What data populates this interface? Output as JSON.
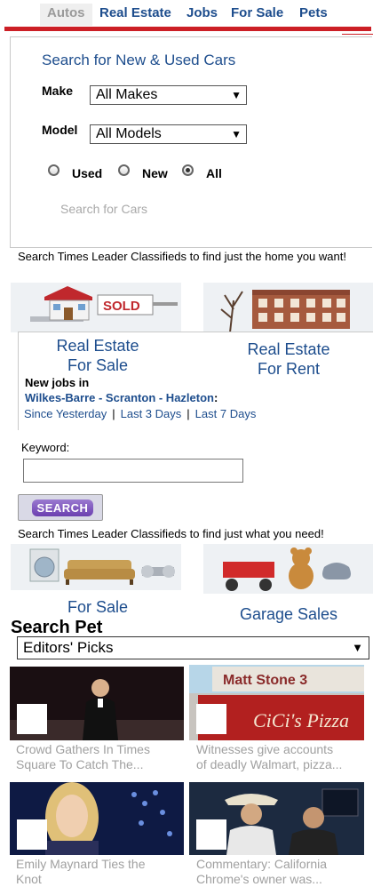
{
  "tabs": [
    "Autos",
    "Real Estate",
    "Jobs",
    "For Sale",
    "Pets"
  ],
  "cars": {
    "title": "Search for New & Used Cars",
    "make_label": "Make",
    "make_value": "All Makes",
    "model_label": "Model",
    "model_value": "All Models",
    "radio_used": "Used",
    "radio_new": "New",
    "radio_all": "All",
    "selected": "All",
    "search_text": "Search for Cars"
  },
  "realestate": {
    "blurb": "Search Times Leader Classifieds to find just the home you want!",
    "sale_label_1": "Real Estate",
    "sale_label_2": "For Sale",
    "rent_label_1": "Real Estate",
    "rent_label_2": "For Rent",
    "sold_sign": "SOLD"
  },
  "jobs": {
    "heading": "New jobs in",
    "cities": "Wilkes-Barre - Scranton - Hazleton",
    "cities_suffix": ":",
    "link_1": "Since Yesterday",
    "link_2": "Last 3 Days",
    "link_3": "Last 7 Days",
    "sep": "|",
    "keyword_label": "Keyword:",
    "keyword_value": "",
    "search_button": "SEARCH"
  },
  "forsale": {
    "blurb": "Search Times Leader Classifieds to find just what you need!",
    "for_sale_label": "For Sale",
    "garage_label": "Garage Sales"
  },
  "pets": {
    "title": "Search Pet",
    "dropdown": "Editors' Picks"
  },
  "videos": [
    {
      "caption_1": "Crowd Gathers In Times",
      "caption_2": "Square To Catch The..."
    },
    {
      "caption_1": "Witnesses give accounts",
      "caption_2": "of deadly Walmart, pizza...",
      "sign_1": "Matt Stone 3",
      "sign_2": "CiCi's Pizza"
    },
    {
      "caption_1": "Emily Maynard Ties the",
      "caption_2": "Knot"
    },
    {
      "caption_1": "Commentary: California",
      "caption_2": "Chrome's owner was..."
    }
  ],
  "colors": {
    "accent": "#cc1f26",
    "link": "#1d4d8d"
  }
}
